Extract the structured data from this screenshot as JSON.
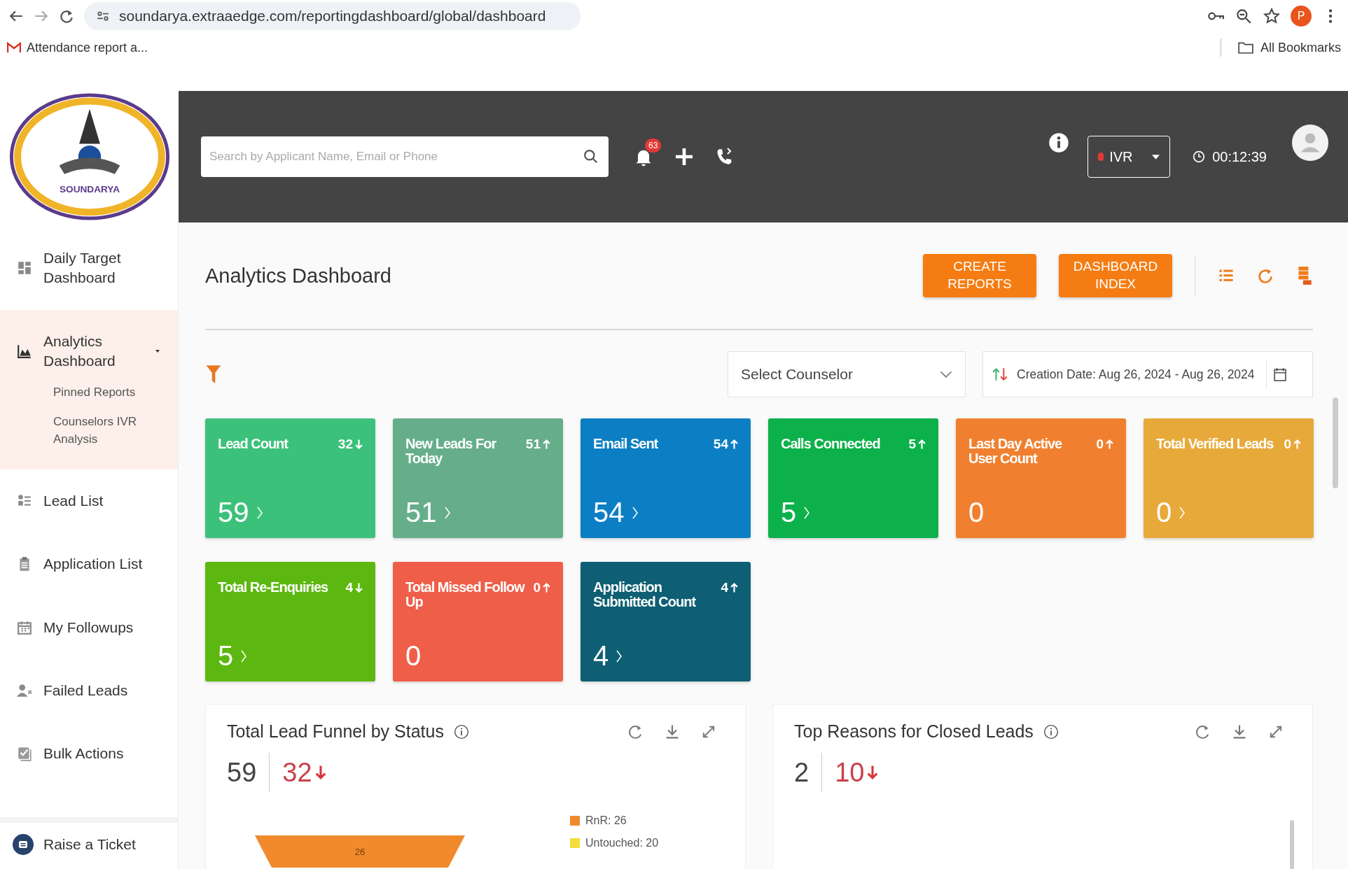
{
  "browser": {
    "url": "soundarya.extraaedge.com/reportingdashboard/global/dashboard",
    "profile_initial": "P",
    "bookmarks": [
      {
        "label": "Attendance report a..."
      }
    ],
    "all_bookmarks": "All Bookmarks"
  },
  "header": {
    "logo_text": "SOUNDARYA",
    "search_placeholder": "Search by Applicant Name, Email or Phone",
    "notification_count": "63",
    "ivr": {
      "label": "IVR",
      "online": false
    },
    "timer": "00:12:39"
  },
  "sidebar": {
    "items": [
      {
        "label": "Daily Target Dashboard",
        "selected": false
      },
      {
        "label": "Analytics Dashboard",
        "selected": true,
        "expanded": true,
        "children": [
          {
            "label": "Pinned Reports"
          },
          {
            "label": "Counselors IVR Analysis"
          }
        ]
      },
      {
        "label": "Lead List",
        "selected": false
      },
      {
        "label": "Application List",
        "selected": false
      },
      {
        "label": "My Followups",
        "selected": false
      },
      {
        "label": "Failed Leads",
        "selected": false
      },
      {
        "label": "Bulk Actions",
        "selected": false
      }
    ],
    "footer": {
      "label": "Raise a Ticket"
    }
  },
  "page": {
    "title": "Analytics Dashboard",
    "buttons": [
      "CREATE REPORTS",
      "DASHBOARD INDEX"
    ],
    "counselor_select": {
      "placeholder": "Select Counselor"
    },
    "date_range": "Creation Date: Aug 26, 2024 - Aug 26, 2024"
  },
  "cards": [
    {
      "title": "Lead Count",
      "delta": "32",
      "rising": false,
      "value": "59",
      "link": true,
      "color": "#3cc17a"
    },
    {
      "title": "New Leads For Today",
      "delta": "51",
      "rising": true,
      "value": "51",
      "link": true,
      "color": "#66ae8a"
    },
    {
      "title": "Email Sent",
      "delta": "54",
      "rising": true,
      "value": "54",
      "link": true,
      "color": "#0c7fc4"
    },
    {
      "title": "Calls Connected",
      "delta": "5",
      "rising": true,
      "value": "5",
      "link": true,
      "color": "#0db14b"
    },
    {
      "title": "Last Day Active User Count",
      "delta": "0",
      "rising": true,
      "value": "0",
      "link": false,
      "color": "#f0802f"
    },
    {
      "title": "Total Verified Leads",
      "delta": "0",
      "rising": true,
      "value": "0",
      "link": true,
      "color": "#e7a93a"
    },
    {
      "title": "Total Re-Enquiries",
      "delta": "4",
      "rising": false,
      "value": "5",
      "link": true,
      "color": "#5cb810"
    },
    {
      "title": "Total Missed Follow Up",
      "delta": "0",
      "rising": true,
      "value": "0",
      "link": false,
      "color": "#ee5e48"
    },
    {
      "title": "Application Submitted Count",
      "delta": "4",
      "rising": true,
      "value": "4",
      "link": true,
      "color": "#0e5f73"
    }
  ],
  "panels": [
    {
      "title": "Total Lead Funnel by Status",
      "total": "59",
      "change": "32",
      "rising": false,
      "funnel": [
        {
          "label": "26",
          "color": "#f08a2c"
        }
      ],
      "legend": [
        {
          "label": "RnR: 26",
          "color": "#f08a2c"
        },
        {
          "label": "Untouched: 20",
          "color": "#f2dd3c"
        }
      ]
    },
    {
      "title": "Top Reasons for Closed Leads",
      "total": "2",
      "change": "10",
      "rising": false
    }
  ]
}
